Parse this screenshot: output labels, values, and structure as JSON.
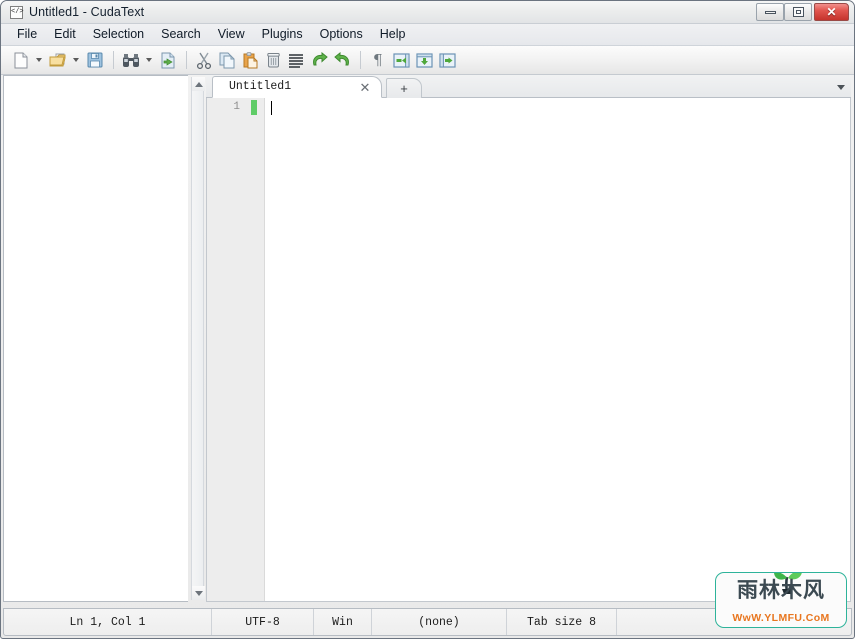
{
  "window": {
    "title": "Untitled1 - CudaText",
    "app_icon": "code-brackets-icon",
    "controls": {
      "minimize_label": "minimize-icon",
      "maximize_label": "maximize-icon",
      "close_label": "✕"
    }
  },
  "menubar": {
    "items": [
      {
        "label": "File"
      },
      {
        "label": "Edit"
      },
      {
        "label": "Selection"
      },
      {
        "label": "Search"
      },
      {
        "label": "View"
      },
      {
        "label": "Plugins"
      },
      {
        "label": "Options"
      },
      {
        "label": "Help"
      }
    ]
  },
  "toolbar": {
    "items": [
      {
        "name": "new-file-icon",
        "tooltip": "New file"
      },
      {
        "name": "new-file-dropdown",
        "tooltip": "New file menu"
      },
      {
        "name": "open-file-icon",
        "tooltip": "Open file"
      },
      {
        "name": "open-file-dropdown",
        "tooltip": "Recent files"
      },
      {
        "name": "save-file-icon",
        "tooltip": "Save"
      },
      {
        "name": "find-icon",
        "tooltip": "Find"
      },
      {
        "name": "find-dropdown",
        "tooltip": "Find menu"
      },
      {
        "name": "goto-icon",
        "tooltip": "Go to"
      },
      {
        "name": "cut-icon",
        "tooltip": "Cut"
      },
      {
        "name": "copy-icon",
        "tooltip": "Copy"
      },
      {
        "name": "paste-icon",
        "tooltip": "Paste"
      },
      {
        "name": "delete-icon",
        "tooltip": "Delete"
      },
      {
        "name": "select-all-icon",
        "tooltip": "Select all"
      },
      {
        "name": "undo-icon",
        "tooltip": "Undo"
      },
      {
        "name": "redo-icon",
        "tooltip": "Redo"
      },
      {
        "name": "show-whitespace-icon",
        "tooltip": "Toggle unprinted"
      },
      {
        "name": "unindent-icon",
        "tooltip": "Unindent"
      },
      {
        "name": "toggle-comment-icon",
        "tooltip": "Comment"
      },
      {
        "name": "indent-icon",
        "tooltip": "Indent"
      }
    ]
  },
  "tabbar": {
    "active_tab_label": "Untitled1",
    "close_glyph": "✕",
    "new_tab_glyph": "+",
    "menu_icon": "chevron-down-icon"
  },
  "editor": {
    "line_numbers": [
      "1"
    ],
    "content": "",
    "modified_marker_color": "#5fcc67",
    "gutter_color": "#ededed"
  },
  "statusbar": {
    "caret": "Ln 1, Col 1",
    "encoding": "UTF-8",
    "line_ends": "Win",
    "lexer": "(none)",
    "tab_size": "Tab size 8",
    "extra": ""
  },
  "watermark": {
    "characters": "雨林木风",
    "url": "WwW.YLMFU.CoM",
    "border_color": "#2eb39a",
    "url_color": "#e8761f",
    "leaf_icon": "sprout-icon"
  }
}
